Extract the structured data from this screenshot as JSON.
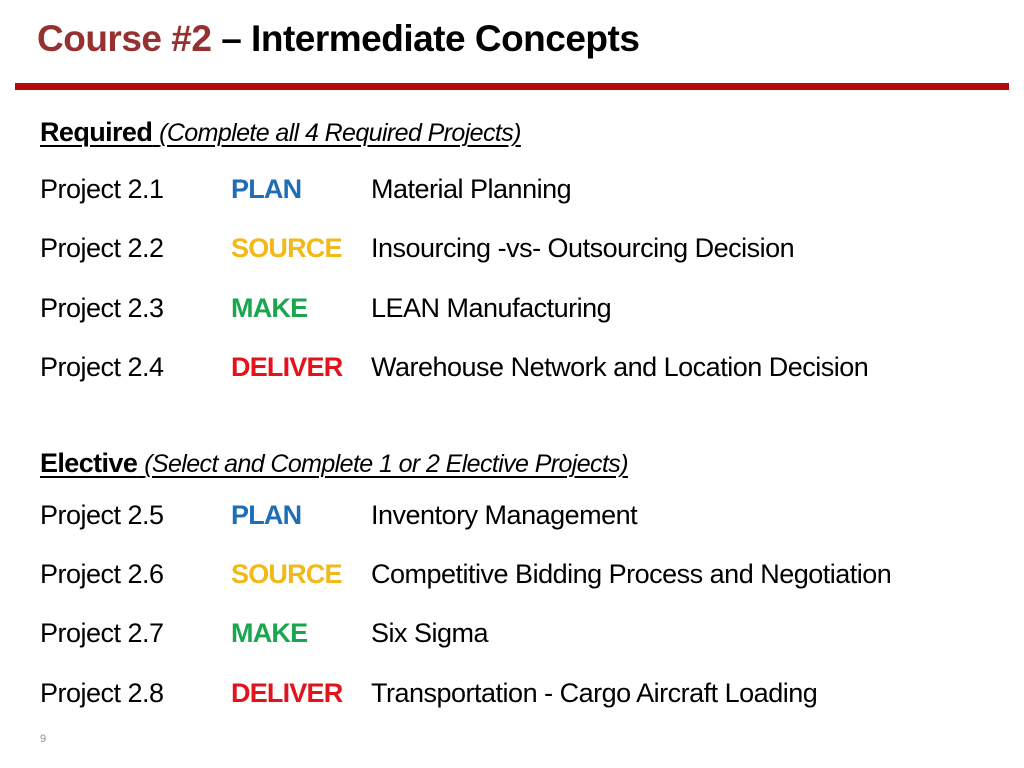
{
  "slide": {
    "title_accent": "Course #2",
    "title_rest": " – Intermediate Concepts",
    "page_number": "9"
  },
  "colors": {
    "title_accent": "#953130",
    "rule": "#b30a0a",
    "PLAN": "#1f6eb5",
    "SOURCE": "#f2b91b",
    "MAKE": "#1aa64f",
    "DELIVER": "#e3131b"
  },
  "required": {
    "heading": "Required",
    "note": "(Complete all 4 Required Projects)",
    "projects": [
      {
        "id": "Project 2.1",
        "phase": "PLAN",
        "description": "Material Planning"
      },
      {
        "id": "Project 2.2",
        "phase": "SOURCE",
        "description": "Insourcing -vs- Outsourcing Decision"
      },
      {
        "id": "Project 2.3",
        "phase": "MAKE",
        "description": "LEAN Manufacturing"
      },
      {
        "id": "Project 2.4",
        "phase": "DELIVER",
        "description": "Warehouse Network and Location Decision"
      }
    ]
  },
  "elective": {
    "heading": "Elective",
    "note": "(Select and Complete 1 or 2 Elective Projects)",
    "projects": [
      {
        "id": "Project 2.5",
        "phase": "PLAN",
        "description": "Inventory Management"
      },
      {
        "id": "Project 2.6",
        "phase": "SOURCE",
        "description": "Competitive Bidding Process and Negotiation"
      },
      {
        "id": "Project 2.7",
        "phase": "MAKE",
        "description": "Six Sigma"
      },
      {
        "id": "Project 2.8",
        "phase": "DELIVER",
        "description": "Transportation - Cargo Aircraft Loading"
      }
    ]
  }
}
